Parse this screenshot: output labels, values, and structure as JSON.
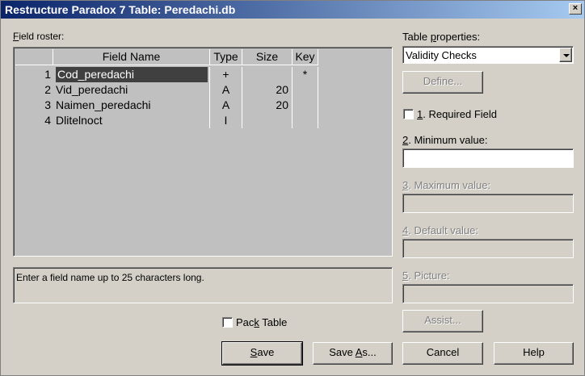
{
  "window": {
    "title": "Restructure Paradox 7 Table: Peredachi.db",
    "close_label": "×"
  },
  "roster": {
    "label_u": "F",
    "label_rest": "ield roster:",
    "columns": {
      "num": "",
      "name": "Field Name",
      "type": "Type",
      "size": "Size",
      "key": "Key"
    },
    "rows": [
      {
        "num": "1",
        "name": "Cod_peredachi",
        "type": "+",
        "size": "",
        "key": "*",
        "selected": true
      },
      {
        "num": "2",
        "name": "Vid_peredachi",
        "type": "A",
        "size": "20",
        "key": ""
      },
      {
        "num": "3",
        "name": "Naimen_peredachi",
        "type": "A",
        "size": "20",
        "key": ""
      },
      {
        "num": "4",
        "name": "Dlitelnoct",
        "type": "I",
        "size": "",
        "key": ""
      }
    ]
  },
  "hint": "Enter a field name up to 25 characters long.",
  "pack_table": {
    "label_pre": "Pac",
    "label_u": "k",
    "label_post": " Table",
    "checked": false
  },
  "properties": {
    "label_pre": "Table ",
    "label_u": "p",
    "label_post": "roperties:",
    "selected": "Validity Checks",
    "define_label": "Define...",
    "required": {
      "num": "1",
      "label": ". Required Field",
      "checked": false
    },
    "minimum": {
      "num": "2",
      "label": ". Minimum value:",
      "value": ""
    },
    "maximum": {
      "num": "3",
      "label": ". Maximum value:",
      "value": ""
    },
    "default": {
      "num": "4",
      "label": ". Default value:",
      "value": ""
    },
    "picture": {
      "num": "5",
      "label": ". Picture:",
      "value": ""
    },
    "assist_label": "Assist..."
  },
  "buttons": {
    "save_u": "S",
    "save_rest": "ave",
    "saveas_pre": "Save ",
    "saveas_u": "A",
    "saveas_post": "s...",
    "cancel": "Cancel",
    "help": "Help"
  }
}
